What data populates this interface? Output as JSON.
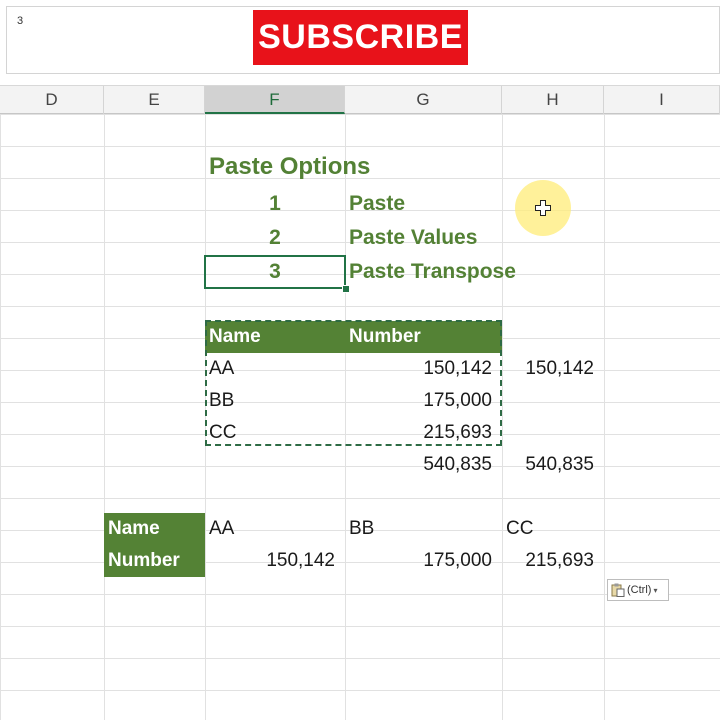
{
  "formula_bar": {
    "value": "3"
  },
  "banner": {
    "label": "SUBSCRIBE"
  },
  "columns": [
    "D",
    "E",
    "F",
    "G",
    "H",
    "I"
  ],
  "selected_column": "F",
  "paste_options": {
    "title": "Paste Options",
    "items": [
      {
        "number": "1",
        "label": "Paste"
      },
      {
        "number": "2",
        "label": "Paste Values"
      },
      {
        "number": "3",
        "label": "Paste Transpose"
      }
    ]
  },
  "source_table": {
    "headers": [
      "Name",
      "Number"
    ],
    "rows": [
      {
        "name": "AA",
        "number": "150,142",
        "extra": "150,142"
      },
      {
        "name": "BB",
        "number": "175,000",
        "extra": ""
      },
      {
        "name": "CC",
        "number": "215,693",
        "extra": ""
      }
    ],
    "total": "540,835",
    "total_extra": "540,835"
  },
  "transposed": {
    "row_headers": [
      "Name",
      "Number"
    ],
    "names": [
      "AA",
      "BB",
      "CC"
    ],
    "numbers": [
      "150,142",
      "175,000",
      "215,693"
    ]
  },
  "paste_button": {
    "label": "(Ctrl)"
  },
  "colors": {
    "accent_green": "#538135",
    "header_fill": "#548235",
    "banner_red": "#e8121a",
    "selection": "#217346"
  }
}
